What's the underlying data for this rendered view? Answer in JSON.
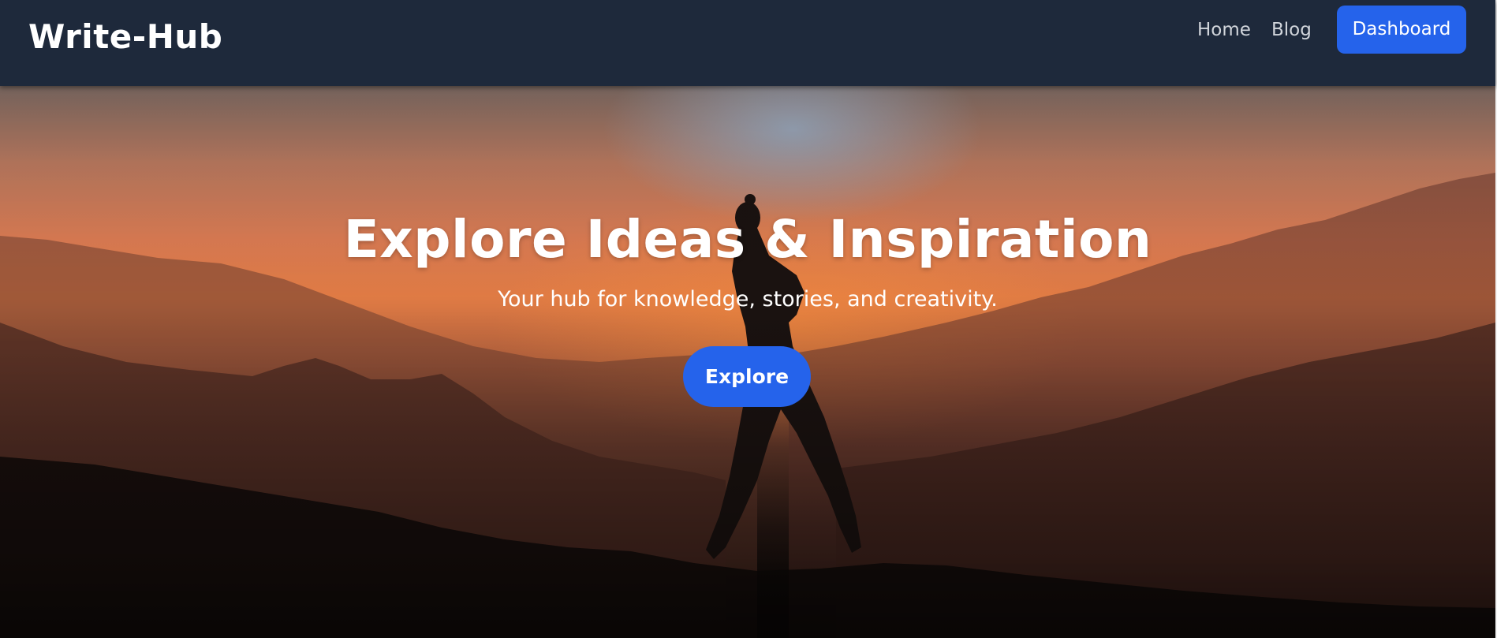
{
  "navbar": {
    "brand": "Write-Hub",
    "links": [
      {
        "label": "Home"
      },
      {
        "label": "Blog"
      }
    ],
    "dashboard_label": "Dashboard"
  },
  "hero": {
    "title": "Explore Ideas & Inspiration",
    "subtitle": "Your hub for knowledge, stories, and creativity.",
    "cta_label": "Explore",
    "background_image": "silhouette-person-mountain-sunset"
  },
  "colors": {
    "navbar_bg": "#1e293b",
    "accent": "#2563eb",
    "text_light": "#ffffff",
    "nav_link": "#d1d5db"
  }
}
